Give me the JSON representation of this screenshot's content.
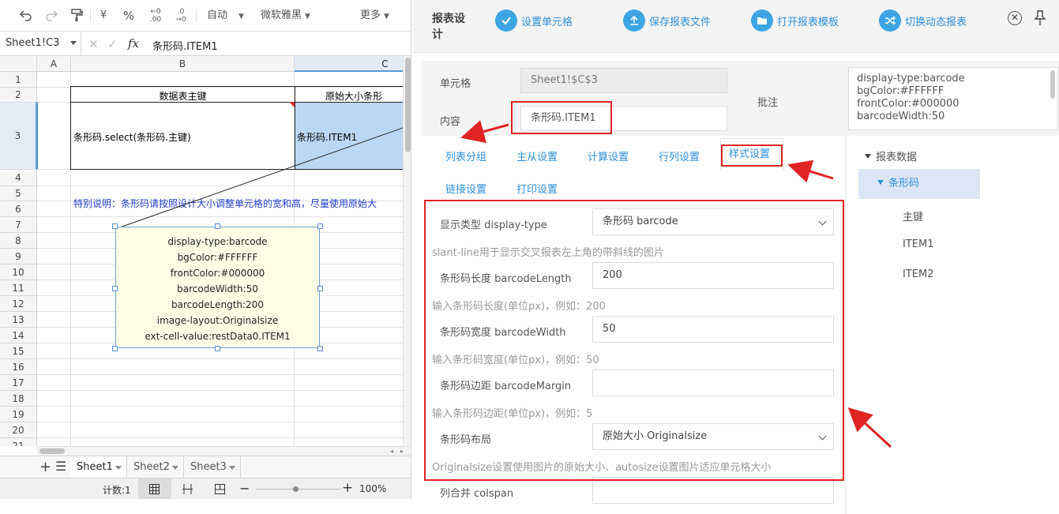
{
  "toolbar": {
    "auto_label": "自动",
    "font_name": "微软雅黑",
    "more_label": "更多",
    "currency_symbol": "¥",
    "percent_symbol": "%",
    "decimals_inc": ".00",
    "decimals_dec": ".0"
  },
  "formula_bar": {
    "name_box": "Sheet1!C3",
    "fx": "fx",
    "formula": "条形码.ITEM1"
  },
  "grid": {
    "columns": [
      "A",
      "B",
      "C"
    ],
    "rows": [
      "1",
      "2",
      "3",
      "4",
      "5",
      "6",
      "7",
      "8",
      "9",
      "10",
      "11",
      "12",
      "13",
      "14",
      "15",
      "16",
      "17",
      "18",
      "19",
      "20",
      "21"
    ],
    "b2": "数据表主键",
    "c2": "原始大小条形",
    "b3": "条形码.select(条形码.主键)",
    "c3": "条形码.ITEM1",
    "note_text": "特别说明：条形码请按照设计大小调整单元格的宽和高，尽量使用原始大"
  },
  "comment_box": {
    "lines": [
      "display-type:barcode",
      "bgColor:#FFFFFF",
      "frontColor:#000000",
      "barcodeWidth:50",
      "barcodeLength:200",
      "image-layout:Originalsize",
      "ext-cell-value:restData0.ITEM1"
    ]
  },
  "sheet_tabs": [
    "Sheet1",
    "Sheet2",
    "Sheet3"
  ],
  "status": {
    "count": "计数:1",
    "zoom": "100%"
  },
  "panel": {
    "title": "报表设计",
    "buttons": [
      "设置单元格",
      "保存报表文件",
      "打开报表模板",
      "切换动态报表"
    ],
    "cell_label": "单元格",
    "cell_value": "Sheet1!$C$3",
    "content_label": "内容",
    "content_value": "条形码.ITEM1",
    "note_label": "批注",
    "note_lines": [
      "display-type:barcode",
      "bgColor:#FFFFFF",
      "frontColor:#000000",
      "barcodeWidth:50"
    ]
  },
  "tabs": [
    "列表分组",
    "主从设置",
    "计算设置",
    "行列设置",
    "样式设置",
    "链接设置",
    "打印设置"
  ],
  "form": {
    "display_type_label": "显示类型 display-type",
    "display_type_value": "条形码 barcode",
    "display_type_hint": "slant-line用于显示交叉报表左上角的带斜线的图片",
    "length_label": "条形码长度 barcodeLength",
    "length_value": "200",
    "length_hint": "输入条形码长度(单位px)，例如：200",
    "width_label": "条形码宽度 barcodeWidth",
    "width_value": "50",
    "width_hint": "输入条形码宽度(单位px)，例如：50",
    "margin_label": "条形码边距 barcodeMargin",
    "margin_value": "",
    "margin_hint": "输入条形码边距(单位px)，例如：5",
    "layout_label": "条形码布局",
    "layout_value": "原始大小 Originalsize",
    "layout_hint": "Originalsize设置使用图片的原始大小、autosize设置图片适应单元格大小",
    "colspan_label": "列合并 colspan",
    "colspan_value": ""
  },
  "tree": {
    "root": "报表数据",
    "node": "条形码",
    "children": [
      "主键",
      "ITEM1",
      "ITEM2"
    ]
  },
  "colors": {
    "accent": "#3da5e3",
    "link": "#2f8fd8",
    "highlight_red": "#e02424",
    "selected_cell": "#bcd7f5",
    "comment_bg": "#fefee6"
  }
}
